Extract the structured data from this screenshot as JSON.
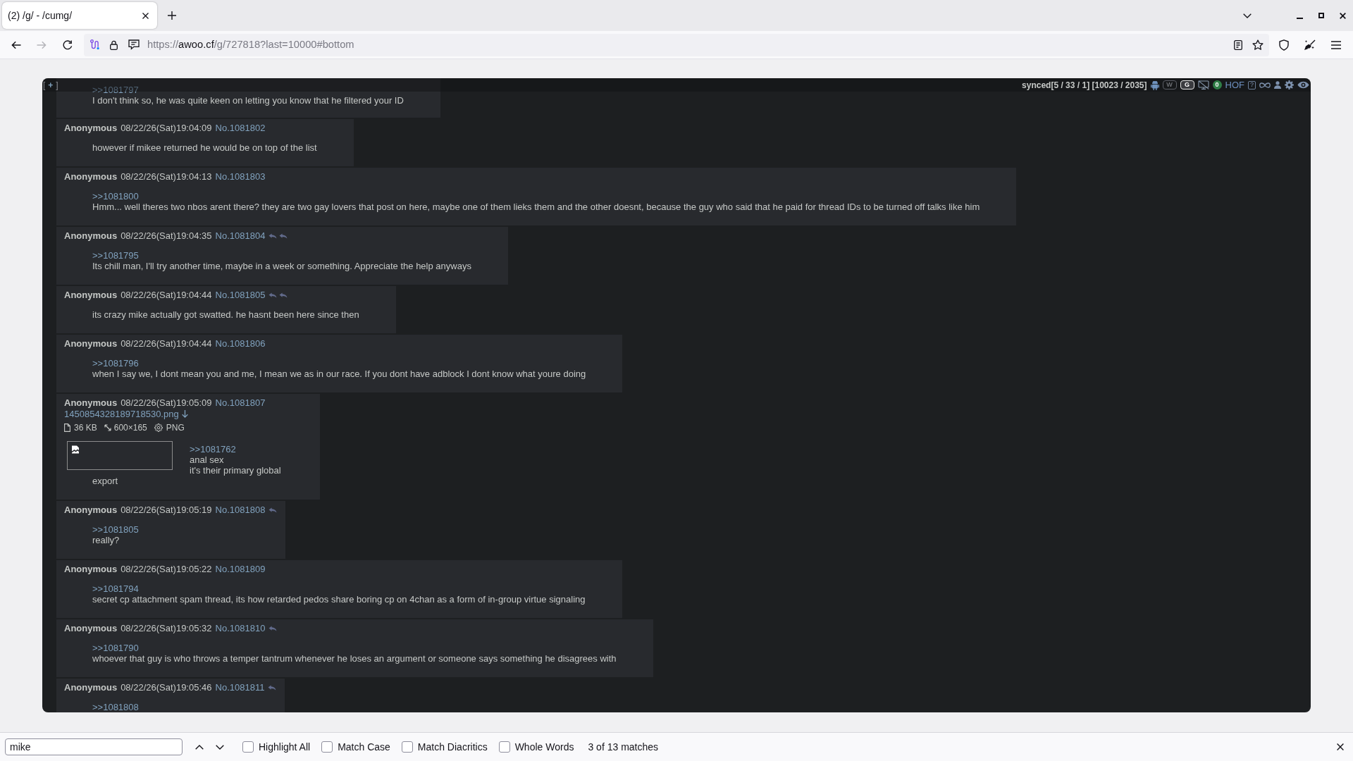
{
  "browser": {
    "tabs": [
      {
        "title": "(2) /g/ - /cumg/",
        "selected": true
      }
    ],
    "navigation": {
      "back": {
        "disabled": false
      },
      "forward": {
        "disabled": true
      }
    },
    "url": {
      "scheme": "https://",
      "host": "awoo.cf",
      "path": "/g/727818?last=10000#bottom"
    }
  },
  "thread_header": {
    "toggle": {
      "open": "[",
      "label": "+",
      "close": "]"
    },
    "status": "synced[5 / 33 / 1] [10023 / 2035]",
    "toggles": [
      {
        "label": "W",
        "on": false
      },
      {
        "label": "G",
        "on": true
      }
    ],
    "count_badge": "0",
    "link": "HOF",
    "help": "?"
  },
  "posts": [
    {
      "body": [
        {
          "kind": "quote",
          "text": ">>1081797"
        },
        {
          "kind": "text",
          "text": "I don't think so, he was quite keen on letting you know that he filtered your ID"
        }
      ]
    },
    {
      "author": "Anonymous",
      "date": "08/22/26(Sat)19:04:09",
      "number": "No.1081802",
      "body": [
        {
          "kind": "text",
          "text": "however if mikee returned he would be on top of the list"
        }
      ]
    },
    {
      "author": "Anonymous",
      "date": "08/22/26(Sat)19:04:13",
      "number": "No.1081803",
      "body": [
        {
          "kind": "quote",
          "text": ">>1081800"
        },
        {
          "kind": "text",
          "text": "Hmm... well theres two nbos arent there? they are two gay lovers that post on here, maybe one of them lieks them and the other doesnt, because the guy who said that he paid for thread IDs to be turned off talks like him"
        }
      ]
    },
    {
      "author": "Anonymous",
      "date": "08/22/26(Sat)19:04:35",
      "number": "No.1081804",
      "backlinks": [
        {
          "kind": "reply"
        },
        {
          "kind": "reply"
        }
      ],
      "body": [
        {
          "kind": "quote",
          "text": ">>1081795"
        },
        {
          "kind": "text",
          "text": "Its chill man, I'll try another time, maybe in a week or something. Appreciate the help anyways"
        }
      ]
    },
    {
      "author": "Anonymous",
      "date": "08/22/26(Sat)19:04:44",
      "number": "No.1081805",
      "backlinks": [
        {
          "kind": "reply"
        },
        {
          "kind": "reply"
        }
      ],
      "body": [
        {
          "kind": "text",
          "text": "its crazy mike actually got swatted. he hasnt been here since then"
        }
      ]
    },
    {
      "author": "Anonymous",
      "date": "08/22/26(Sat)19:04:44",
      "number": "No.1081806",
      "body": [
        {
          "kind": "quote",
          "text": ">>1081796"
        },
        {
          "kind": "text",
          "text": "when I say we, I dont mean you and me, I mean we as in our race. If you dont have adblock I dont know what youre doing"
        }
      ]
    },
    {
      "author": "Anonymous",
      "date": "08/22/26(Sat)19:05:09",
      "number": "No.1081807",
      "file": {
        "name": "1450854328189718530.png",
        "size": "36 KB",
        "dimensions": "600×165",
        "format": "PNG"
      },
      "body": [
        {
          "kind": "quote",
          "text": ">>1081762"
        },
        {
          "kind": "text",
          "text": "anal sex"
        },
        {
          "kind": "text",
          "text": "it's their primary global export"
        }
      ]
    },
    {
      "author": "Anonymous",
      "date": "08/22/26(Sat)19:05:19",
      "number": "No.1081808",
      "backlinks": [
        {
          "kind": "reply"
        }
      ],
      "body": [
        {
          "kind": "quote",
          "text": ">>1081805"
        },
        {
          "kind": "text",
          "text": "really?"
        }
      ]
    },
    {
      "author": "Anonymous",
      "date": "08/22/26(Sat)19:05:22",
      "number": "No.1081809",
      "body": [
        {
          "kind": "quote",
          "text": ">>1081794"
        },
        {
          "kind": "text",
          "text": "secret cp attachment spam thread, its how retarded pedos share boring cp on 4chan as a form of in-group virtue signaling"
        }
      ]
    },
    {
      "author": "Anonymous",
      "date": "08/22/26(Sat)19:05:32",
      "number": "No.1081810",
      "backlinks": [
        {
          "kind": "reply"
        }
      ],
      "body": [
        {
          "kind": "quote",
          "text": ">>1081790"
        },
        {
          "kind": "text",
          "text": "whoever that guy is who throws a temper tantrum whenever he loses an argument or someone says something he disagrees with"
        }
      ]
    },
    {
      "author": "Anonymous",
      "date": "08/22/26(Sat)19:05:46",
      "number": "No.1081811",
      "backlinks": [
        {
          "kind": "reply"
        }
      ],
      "body": [
        {
          "kind": "quote",
          "text": ">>1081808"
        }
      ]
    }
  ],
  "find_bar": {
    "query": "mike",
    "options": [
      {
        "label": "Highlight All",
        "checked": false
      },
      {
        "label": "Match Case",
        "checked": false
      },
      {
        "label": "Match Diacritics",
        "checked": false
      },
      {
        "label": "Whole Words",
        "checked": false
      }
    ],
    "match_count": "3 of 13 matches"
  }
}
